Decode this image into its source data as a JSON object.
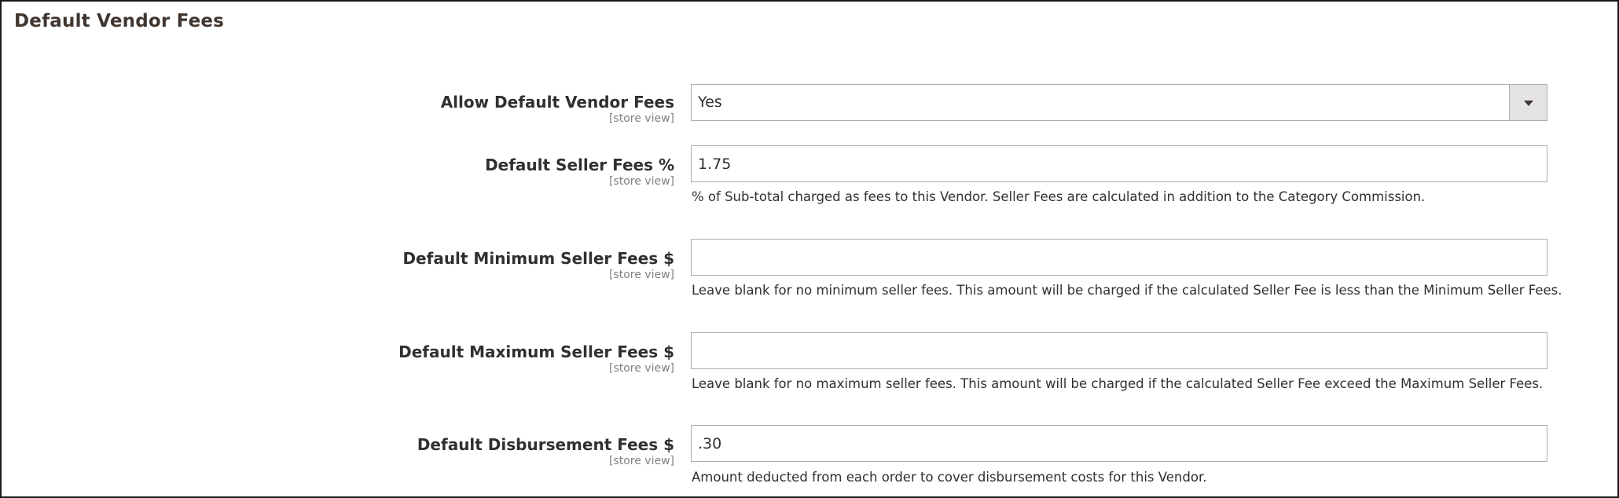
{
  "section": {
    "title": "Default Vendor Fees"
  },
  "fields": {
    "allow_default_vendor_fees": {
      "label": "Allow Default Vendor Fees",
      "scope": "[store view]",
      "value": "Yes"
    },
    "default_seller_fees_percent": {
      "label": "Default Seller Fees %",
      "scope": "[store view]",
      "value": "1.75",
      "note": "% of Sub-total charged as fees to this Vendor. Seller Fees are calculated in addition to the Category Commission."
    },
    "default_minimum_seller_fees": {
      "label": "Default Minimum Seller Fees $",
      "scope": "[store view]",
      "value": "",
      "note": "Leave blank for no minimum seller fees. This amount will be charged if the calculated Seller Fee is less than the Minimum Seller Fees."
    },
    "default_maximum_seller_fees": {
      "label": "Default Maximum Seller Fees $",
      "scope": "[store view]",
      "value": "",
      "note": "Leave blank for no maximum seller fees. This amount will be charged if the calculated Seller Fee exceed the Maximum Seller Fees."
    },
    "default_disbursement_fees": {
      "label": "Default Disbursement Fees $",
      "scope": "[store view]",
      "value": ".30",
      "note": "Amount deducted from each order to cover disbursement costs for this Vendor."
    }
  },
  "icons": {
    "select_arrow": "chevron-down-icon"
  }
}
